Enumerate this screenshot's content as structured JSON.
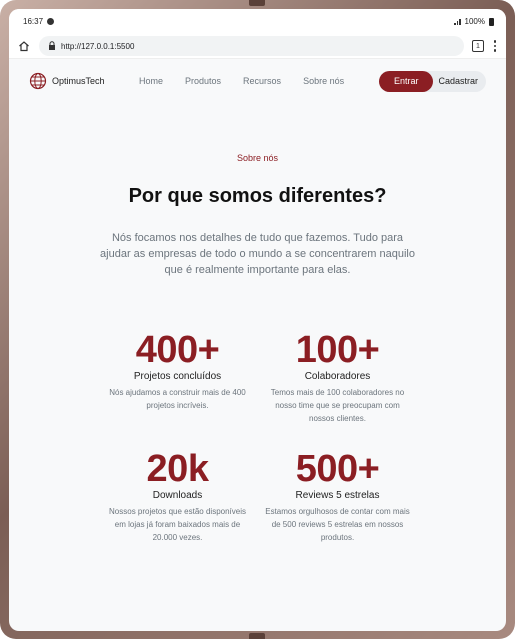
{
  "statusbar": {
    "time": "16:37",
    "battery": "100%"
  },
  "browser": {
    "url": "http://127.0.0.1:5500",
    "tab_count": "1"
  },
  "navbar": {
    "brand": "OptimusTech",
    "links": [
      "Home",
      "Produtos",
      "Recursos",
      "Sobre nós"
    ],
    "login_label": "Entrar",
    "signup_label": "Cadastrar"
  },
  "section": {
    "eyebrow": "Sobre nós",
    "title": "Por que somos diferentes?",
    "lead": "Nós focamos nos detalhes de tudo que fazemos. Tudo para ajudar as empresas de todo o mundo a se concentrarem naquilo que é realmente importante para elas."
  },
  "stats": [
    {
      "value": "400+",
      "title": "Projetos concluídos",
      "desc": "Nós ajudamos a construir mais de 400 projetos incríveis."
    },
    {
      "value": "100+",
      "title": "Colaboradores",
      "desc": "Temos mais de 100 colaboradores no nosso time que se preocupam com nossos clientes."
    },
    {
      "value": "20k",
      "title": "Downloads",
      "desc": "Nossos projetos que estão disponíveis em lojas já foram baixados mais de 20.000 vezes."
    },
    {
      "value": "500+",
      "title": "Reviews 5 estrelas",
      "desc": "Estamos orgulhosos de contar com mais de 500 reviews 5 estrelas em nossos produtos."
    }
  ],
  "colors": {
    "accent": "#8b1e23",
    "muted": "#6c757d",
    "background": "#f8f9fa"
  },
  "icons": {
    "status": "notification-dot-icon",
    "brand": "globe-icon",
    "home": "home-icon",
    "lock": "lock-icon",
    "menu": "kebab-menu-icon"
  }
}
